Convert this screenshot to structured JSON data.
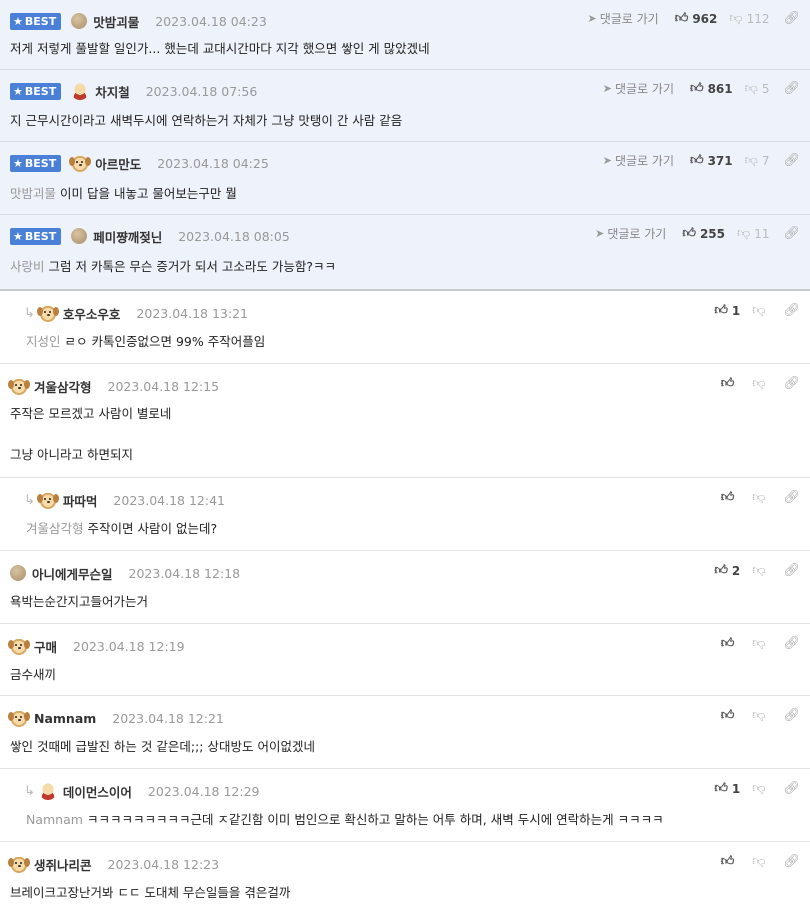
{
  "ui": {
    "best_label": "BEST",
    "goto_label": "댓글로 가기"
  },
  "comments": [
    {
      "nick": "맛밤괴물",
      "date": "2023.04.18 04:23",
      "text": "저게 저렇게 풀발할 일인가... 했는데 교대시간마다 지각 했으면 쌓인 게 많았겠네",
      "likes": "962",
      "dislikes": "112"
    },
    {
      "nick": "차지철",
      "date": "2023.04.18 07:56",
      "text": "지 근무시간이라고 새벽두시에 연락하는거 자체가 그냥 맛탱이 간 사람 같음",
      "likes": "861",
      "dislikes": "5"
    },
    {
      "nick": "아르만도",
      "date": "2023.04.18 04:25",
      "mention": "맛밤괴물",
      "text": "이미 답을 내놓고 물어보는구만 뭘",
      "likes": "371",
      "dislikes": "7"
    },
    {
      "nick": "페미쨩깨젖닌",
      "date": "2023.04.18 08:05",
      "mention": "사랑비",
      "text": "그럼 저 카톡은 무슨 증거가 되서 고소라도 가능함?ㅋㅋ",
      "likes": "255",
      "dislikes": "11"
    },
    {
      "nick": "호우소우호",
      "date": "2023.04.18 13:21",
      "mention": "지성인",
      "text": "ㄹㅇ 카톡인증없으면 99% 주작어플임",
      "likes": "1"
    },
    {
      "nick": "겨울삼각형",
      "date": "2023.04.18 12:15",
      "text": "주작은 모르겠고 사람이 별로네",
      "text2": "그냥 아니라고 하면되지"
    },
    {
      "nick": "파따먹",
      "date": "2023.04.18 12:41",
      "mention": "겨울삼각형",
      "text": "주작이면 사람이 없는데?"
    },
    {
      "nick": "아니에게무슨일",
      "date": "2023.04.18 12:18",
      "text": "욕박는순간지고들어가는거",
      "likes": "2"
    },
    {
      "nick": "구매",
      "date": "2023.04.18 12:19",
      "text": "금수새끼"
    },
    {
      "nick": "Namnam",
      "date": "2023.04.18 12:21",
      "text": "쌓인 것때메 급발진 하는 것 같은데;;; 상대방도 어이없겠네"
    },
    {
      "nick": "데이먼스이어",
      "date": "2023.04.18 12:29",
      "mention": "Namnam",
      "text": "ㅋㅋㅋㅋㅋㅋㅋㅋㅋ근데 ㅈ같긴함 이미 범인으로 확신하고 말하는 어투 하며, 새벽 두시에 연락하는게 ㅋㅋㅋㅋ",
      "likes": "1"
    },
    {
      "nick": "생쥐나리콘",
      "date": "2023.04.18 12:23",
      "text": "브레이크고장난거봐 ㄷㄷ 도대체 무슨일들을 겪은걸까"
    }
  ]
}
